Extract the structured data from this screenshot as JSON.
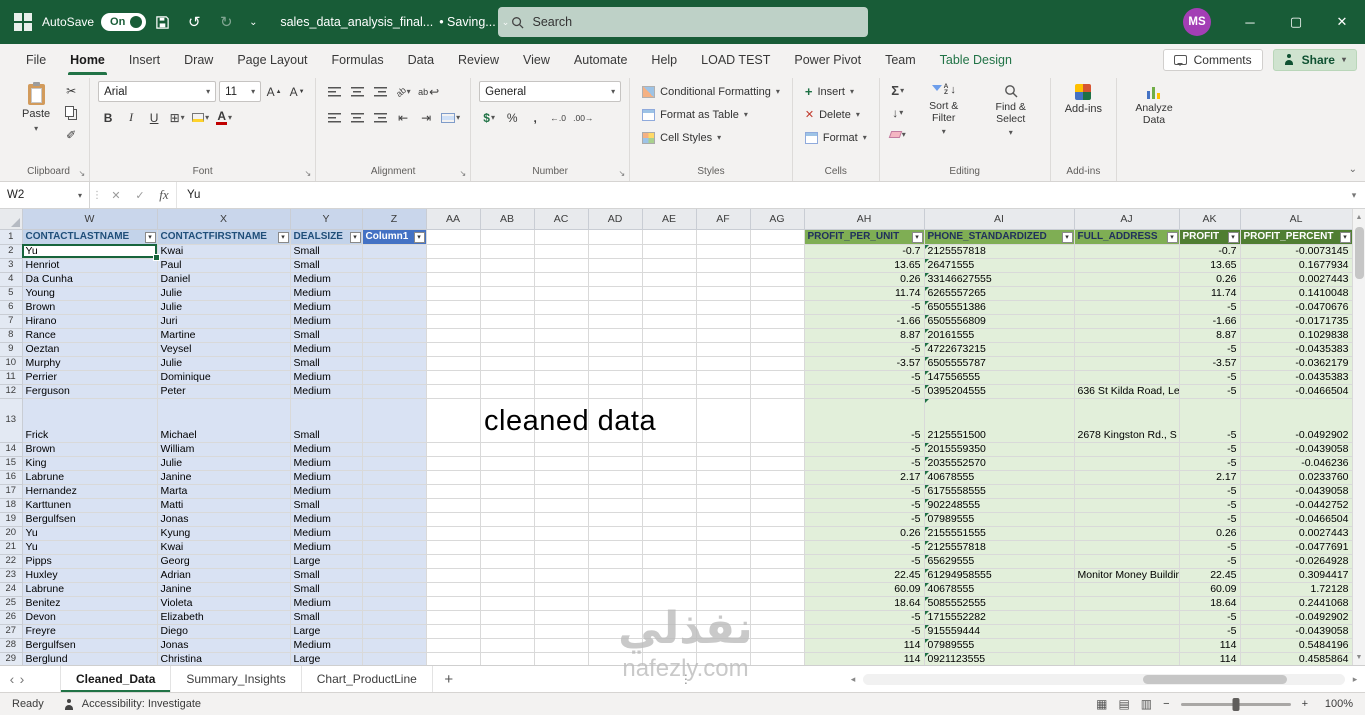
{
  "title_bar": {
    "autosave_label": "AutoSave",
    "autosave_state": "On",
    "filename": "sales_data_analysis_final...",
    "saving_status": "• Saving...",
    "search_placeholder": "Search",
    "avatar_initials": "MS"
  },
  "ribbon_tabs": [
    "File",
    "Home",
    "Insert",
    "Draw",
    "Page Layout",
    "Formulas",
    "Data",
    "Review",
    "View",
    "Automate",
    "Help",
    "LOAD TEST",
    "Power Pivot",
    "Team",
    "Table Design"
  ],
  "top_right": {
    "comments": "Comments",
    "share": "Share"
  },
  "ribbon": {
    "clipboard": {
      "paste": "Paste",
      "label": "Clipboard"
    },
    "font": {
      "family": "Arial",
      "size": "11",
      "label": "Font"
    },
    "alignment": {
      "label": "Alignment"
    },
    "number": {
      "format": "General",
      "label": "Number"
    },
    "styles": {
      "items": [
        "Conditional Formatting",
        "Format as Table",
        "Cell Styles"
      ],
      "label": "Styles"
    },
    "cells": {
      "items": [
        "Insert",
        "Delete",
        "Format"
      ],
      "label": "Cells"
    },
    "editing": {
      "items": [
        "Sort & Filter",
        "Find & Select"
      ],
      "label": "Editing"
    },
    "addins": {
      "button": "Add-ins",
      "label": "Add-ins"
    },
    "analyze": {
      "button": "Analyze Data"
    }
  },
  "formula_bar": {
    "name_box": "W2",
    "fx_label": "fx",
    "content": "Yu"
  },
  "grid": {
    "columns": [
      "W",
      "X",
      "Y",
      "Z",
      "AA",
      "AB",
      "AC",
      "AD",
      "AE",
      "AF",
      "AG",
      "AH",
      "AI",
      "AJ",
      "AK",
      "AL"
    ],
    "table_headers": {
      "W": "CONTACTLASTNAME",
      "X": "CONTACTFIRSTNAME",
      "Y": "DEALSIZE",
      "Z": "Column1",
      "AH": "PROFIT_PER_UNIT",
      "AI": "PHONE_STANDARDIZED",
      "AJ": "FULL_ADDRESS",
      "AK": "PROFIT",
      "AL": "PROFIT_PERCENT"
    },
    "rows": [
      [
        "Yu",
        "Kwai",
        "Small",
        "-0.7",
        "2125557818",
        "",
        "-0.7",
        "-0.0073145"
      ],
      [
        "Henriot",
        "Paul",
        "Small",
        "13.65",
        "26471555",
        "",
        "13.65",
        "0.1677934"
      ],
      [
        "Da Cunha",
        "Daniel",
        "Medium",
        "0.26",
        "33146627555",
        "",
        "0.26",
        "0.0027443"
      ],
      [
        "Young",
        "Julie",
        "Medium",
        "11.74",
        "6265557265",
        "",
        "11.74",
        "0.1410048"
      ],
      [
        "Brown",
        "Julie",
        "Medium",
        "-5",
        "6505551386",
        "",
        "-5",
        "-0.0470676"
      ],
      [
        "Hirano",
        "Juri",
        "Medium",
        "-1.66",
        "6505556809",
        "",
        "-1.66",
        "-0.0171735"
      ],
      [
        "Rance",
        "Martine",
        "Small",
        "8.87",
        "20161555",
        "",
        "8.87",
        "0.1029838"
      ],
      [
        "Oeztan",
        "Veysel",
        "Medium",
        "-5",
        "4722673215",
        "",
        "-5",
        "-0.0435383"
      ],
      [
        "Murphy",
        "Julie",
        "Small",
        "-3.57",
        "6505555787",
        "",
        "-3.57",
        "-0.0362179"
      ],
      [
        "Perrier",
        "Dominique",
        "Medium",
        "-5",
        "147556555",
        "",
        "-5",
        "-0.0435383"
      ],
      [
        "Ferguson",
        "Peter",
        "Medium",
        "-5",
        "0395204555",
        "636 St Kilda Road, Le",
        "-5",
        "-0.0466504"
      ],
      [
        "Frick",
        "Michael",
        "Small",
        "-5",
        "2125551500",
        "2678 Kingston Rd., S",
        "-5",
        "-0.0492902"
      ],
      [
        "Brown",
        "William",
        "Medium",
        "-5",
        "2015559350",
        "",
        "-5",
        "-0.0439058"
      ],
      [
        "King",
        "Julie",
        "Medium",
        "-5",
        "2035552570",
        "",
        "-5",
        "-0.046236"
      ],
      [
        "Labrune",
        "Janine",
        "Medium",
        "2.17",
        "40678555",
        "",
        "2.17",
        "0.0233760"
      ],
      [
        "Hernandez",
        "Marta",
        "Medium",
        "-5",
        "6175558555",
        "",
        "-5",
        "-0.0439058"
      ],
      [
        "Karttunen",
        "Matti",
        "Small",
        "-5",
        "902248555",
        "",
        "-5",
        "-0.0442752"
      ],
      [
        "Bergulfsen",
        "Jonas",
        "Medium",
        "-5",
        "07989555",
        "",
        "-5",
        "-0.0466504"
      ],
      [
        "Yu",
        "Kyung",
        "Medium",
        "0.26",
        "2155551555",
        "",
        "0.26",
        "0.0027443"
      ],
      [
        "Yu",
        "Kwai",
        "Medium",
        "-5",
        "2125557818",
        "",
        "-5",
        "-0.0477691"
      ],
      [
        "Pipps",
        "Georg",
        "Large",
        "-5",
        "65629555",
        "",
        "-5",
        "-0.0264928"
      ],
      [
        "Huxley",
        "Adrian",
        "Small",
        "22.45",
        "61294958555",
        "Monitor Money Buildin",
        "22.45",
        "0.3094417"
      ],
      [
        "Labrune",
        "Janine",
        "Small",
        "60.09",
        "40678555",
        "",
        "60.09",
        "1.72128"
      ],
      [
        "Benitez",
        "Violeta",
        "Medium",
        "18.64",
        "5085552555",
        "",
        "18.64",
        "0.2441068"
      ],
      [
        "Devon",
        "Elizabeth",
        "Small",
        "-5",
        "1715552282",
        "",
        "-5",
        "-0.0492902"
      ],
      [
        "Freyre",
        "Diego",
        "Large",
        "-5",
        "915559444",
        "",
        "-5",
        "-0.0439058"
      ],
      [
        "Bergulfsen",
        "Jonas",
        "Medium",
        "114",
        "07989555",
        "",
        "114",
        "0.5484196"
      ],
      [
        "Berglund",
        "Christina",
        "Large",
        "114",
        "0921123555",
        "",
        "114",
        "0.4585864"
      ]
    ],
    "overlay_text": "cleaned data"
  },
  "sheet_tabs": {
    "tabs": [
      "Cleaned_Data",
      "Summary_Insights",
      "Chart_ProductLine"
    ],
    "active": "Cleaned_Data",
    "add": "+"
  },
  "status_bar": {
    "mode": "Ready",
    "accessibility": "Accessibility: Investigate",
    "zoom": "100%"
  },
  "watermark": {
    "line1": "نفذلي",
    "line2": "nafezly.com"
  },
  "colors": {
    "titlebar_green": "#185c37",
    "accent_green": "#217346",
    "table_header_blue": "#4472c4",
    "selection_blue": "#d9e2f3",
    "banded_green": "#e2efda",
    "green_header": "#7fae54",
    "green_header_dark": "#507e32",
    "avatar_purple": "#a33eb5"
  }
}
